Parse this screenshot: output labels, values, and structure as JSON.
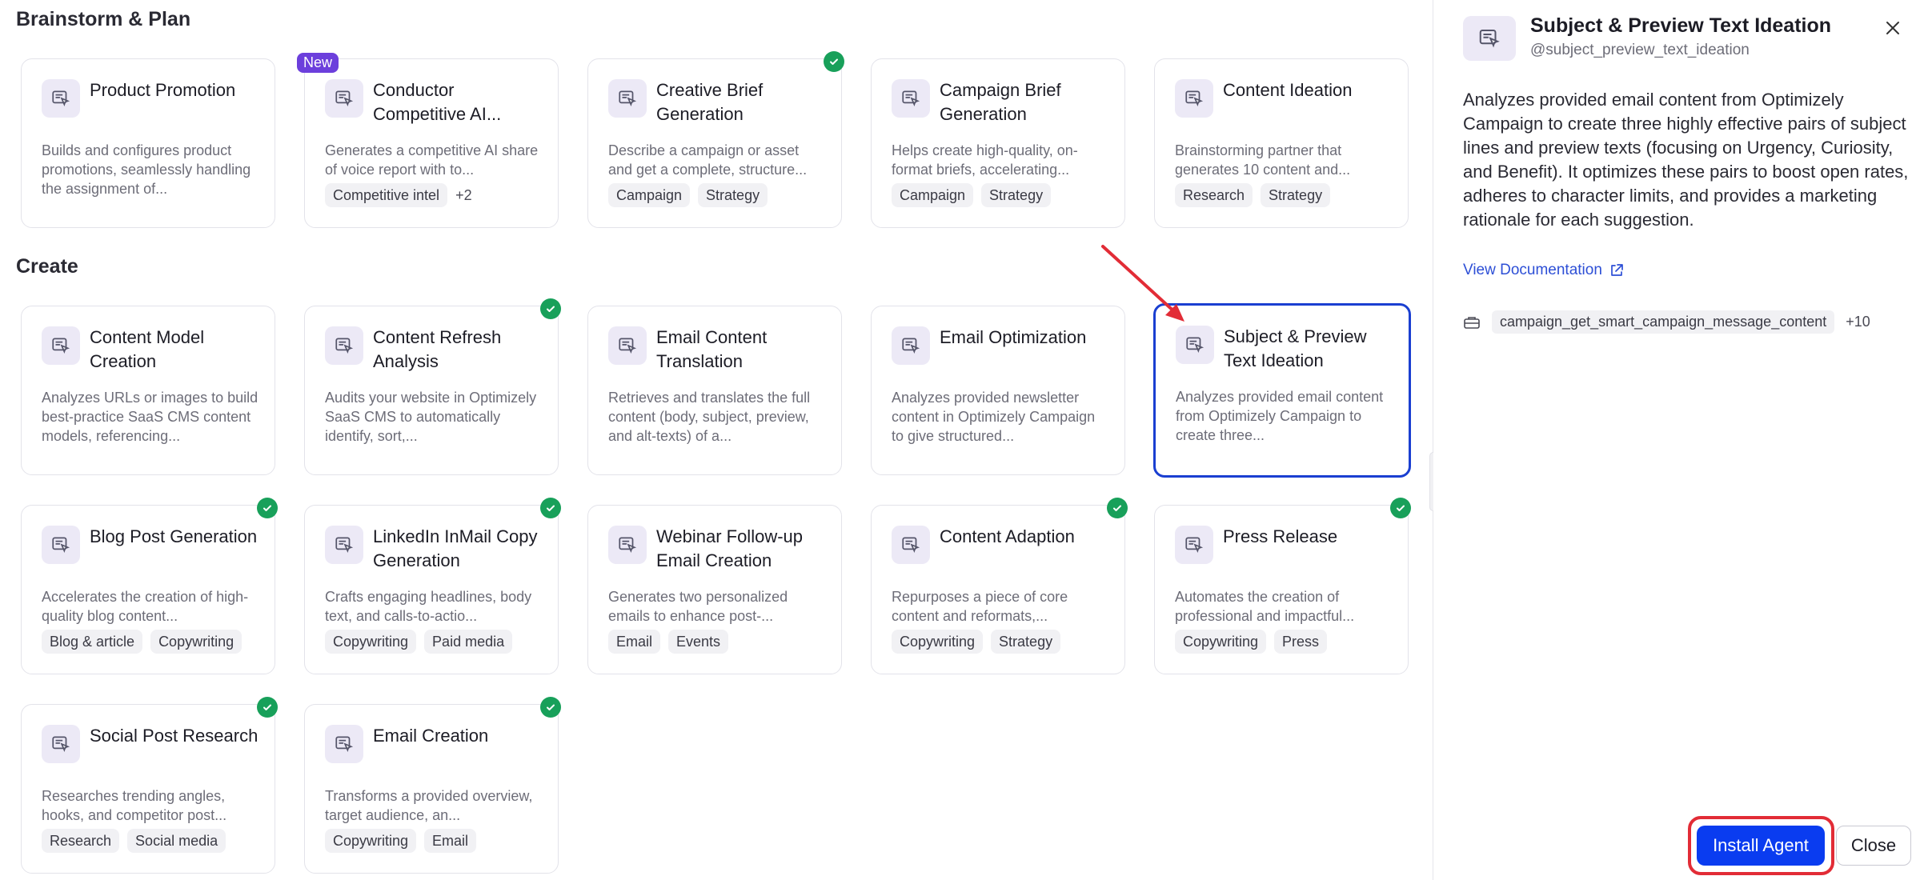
{
  "sections": [
    {
      "title": "Brainstorm & Plan"
    },
    {
      "title": "Create"
    }
  ],
  "cards": [
    {
      "title": "Product Promotion",
      "desc": "Builds and configures product promotions, seamlessly handling the assignment of...",
      "tags": [],
      "more": "",
      "badge": "",
      "checked": false
    },
    {
      "title": "Conductor Competitive AI...",
      "desc": "Generates a competitive AI share of voice report with to...",
      "tags": [
        "Competitive intel"
      ],
      "more": "+2",
      "badge": "New",
      "checked": false
    },
    {
      "title": "Creative Brief Generation",
      "desc": "Describe a campaign or asset and get a complete, structure...",
      "tags": [
        "Campaign",
        "Strategy"
      ],
      "more": "",
      "badge": "",
      "checked": true
    },
    {
      "title": "Campaign Brief Generation",
      "desc": "Helps create high-quality, on-format briefs, accelerating...",
      "tags": [
        "Campaign",
        "Strategy"
      ],
      "more": "",
      "badge": "",
      "checked": false
    },
    {
      "title": "Content Ideation",
      "desc": "Brainstorming partner that generates 10 content and...",
      "tags": [
        "Research",
        "Strategy"
      ],
      "more": "",
      "badge": "",
      "checked": false
    },
    {
      "title": "Content Model Creation",
      "desc": "Analyzes URLs or images to build best-practice SaaS CMS content models, referencing...",
      "tags": [],
      "more": "",
      "badge": "",
      "checked": false
    },
    {
      "title": "Content Refresh Analysis",
      "desc": "Audits your website in Optimizely SaaS CMS to automatically identify, sort,...",
      "tags": [],
      "more": "",
      "badge": "",
      "checked": true
    },
    {
      "title": "Email Content Translation",
      "desc": "Retrieves and translates the full content (body, subject, preview, and alt-texts) of a...",
      "tags": [],
      "more": "",
      "badge": "",
      "checked": false
    },
    {
      "title": "Email Optimization",
      "desc": "Analyzes provided newsletter content in Optimizely Campaign to give structured...",
      "tags": [],
      "more": "",
      "badge": "",
      "checked": false
    },
    {
      "title": "Subject & Preview Text Ideation",
      "desc": "Analyzes provided email content from Optimizely Campaign to create three...",
      "tags": [],
      "more": "",
      "badge": "",
      "checked": false
    },
    {
      "title": "Blog Post Generation",
      "desc": "Accelerates the creation of high-quality blog content...",
      "tags": [
        "Blog & article",
        "Copywriting"
      ],
      "more": "",
      "badge": "",
      "checked": true
    },
    {
      "title": "LinkedIn InMail Copy Generation",
      "desc": "Crafts engaging headlines, body text, and calls-to-actio...",
      "tags": [
        "Copywriting",
        "Paid media"
      ],
      "more": "",
      "badge": "",
      "checked": true
    },
    {
      "title": "Webinar Follow-up Email Creation",
      "desc": "Generates two personalized emails to enhance post-...",
      "tags": [
        "Email",
        "Events"
      ],
      "more": "",
      "badge": "",
      "checked": false
    },
    {
      "title": "Content Adaption",
      "desc": "Repurposes a piece of core content and reformats,...",
      "tags": [
        "Copywriting",
        "Strategy"
      ],
      "more": "",
      "badge": "",
      "checked": true
    },
    {
      "title": "Press Release",
      "desc": "Automates the creation of professional and impactful...",
      "tags": [
        "Copywriting",
        "Press"
      ],
      "more": "",
      "badge": "",
      "checked": true
    },
    {
      "title": "Social Post Research",
      "desc": "Researches trending angles, hooks, and competitor post...",
      "tags": [
        "Research",
        "Social media"
      ],
      "more": "",
      "badge": "",
      "checked": true
    },
    {
      "title": "Email Creation",
      "desc": "Transforms a provided overview, target audience, an...",
      "tags": [
        "Copywriting",
        "Email"
      ],
      "more": "",
      "badge": "",
      "checked": true
    }
  ],
  "panel": {
    "title": "Subject & Preview Text Ideation",
    "handle": "@subject_preview_text_ideation",
    "description": "Analyzes provided email content from Optimizely Campaign to create three highly effective pairs of subject lines and preview texts (focusing on Urgency, Curiosity, and Benefit). It optimizes these pairs to boost open rates, adheres to character limits, and provides a marketing rationale for each suggestion.",
    "doc_link": "View Documentation",
    "tool": "campaign_get_smart_campaign_message_content",
    "tool_more": "+10",
    "install_label": "Install Agent",
    "close_label": "Close"
  },
  "colors": {
    "accent": "#0a3cf0",
    "selected_border": "#1a3fd1",
    "check": "#18a05a",
    "new_badge": "#6c3fdc",
    "annotation": "#e22c36"
  }
}
